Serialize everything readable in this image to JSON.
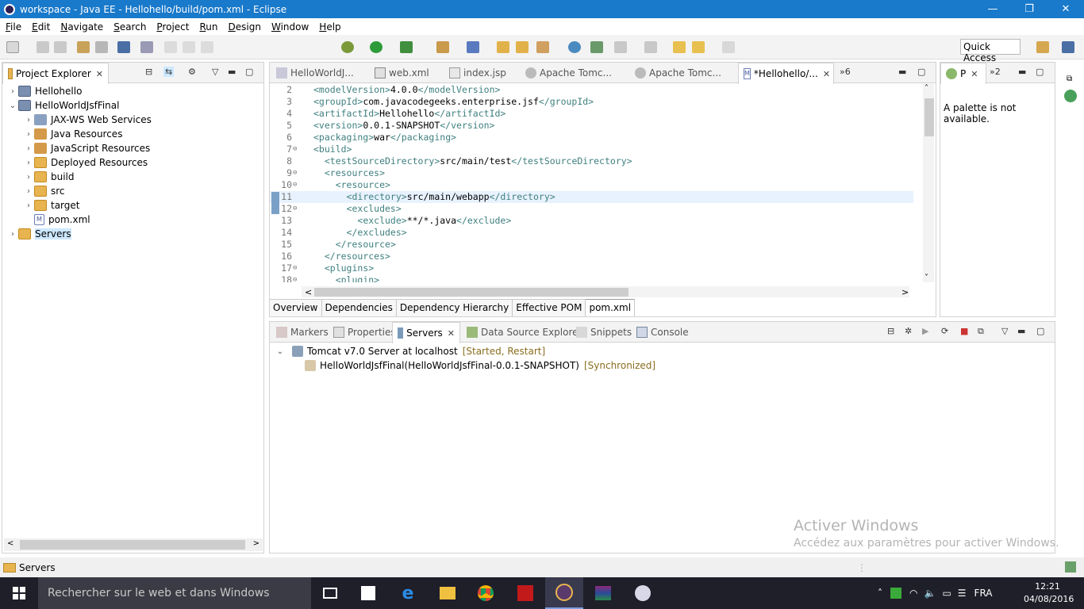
{
  "window": {
    "title": "workspace - Java EE - Hellohello/build/pom.xml - Eclipse",
    "minimize": "—",
    "restore": "❐",
    "close": "✕"
  },
  "menu": [
    "File",
    "Edit",
    "Navigate",
    "Search",
    "Project",
    "Run",
    "Design",
    "Window",
    "Help"
  ],
  "quick_access": "Quick Access",
  "project_explorer": {
    "title": "Project Explorer",
    "items": [
      {
        "label": "Hellohello",
        "twisty": "›"
      },
      {
        "label": "HelloWorldJsfFinal",
        "twisty": "⌄"
      },
      {
        "label": "JAX-WS Web Services",
        "twisty": "›"
      },
      {
        "label": "Java Resources",
        "twisty": "›"
      },
      {
        "label": "JavaScript Resources",
        "twisty": "›"
      },
      {
        "label": "Deployed Resources",
        "twisty": "›"
      },
      {
        "label": "build",
        "twisty": "›"
      },
      {
        "label": "src",
        "twisty": "›"
      },
      {
        "label": "target",
        "twisty": "›"
      },
      {
        "label": "pom.xml",
        "twisty": ""
      },
      {
        "label": "Servers",
        "twisty": "›"
      }
    ]
  },
  "editor": {
    "tabs": [
      "HelloWorldJ...",
      "web.xml",
      "index.jsp",
      "Apache Tomc...",
      "Apache Tomc...",
      "*Hellohello/..."
    ],
    "overflow": "»6",
    "lines": [
      {
        "n": "2",
        "fold": "",
        "indent": "",
        "open": "<modelVersion>",
        "text": "4.0.0",
        "close": "</modelVersion>"
      },
      {
        "n": "3",
        "fold": "",
        "indent": "",
        "open": "<groupId>",
        "text": "com.javacodegeeks.enterprise.jsf",
        "close": "</groupId>"
      },
      {
        "n": "4",
        "fold": "",
        "indent": "",
        "open": "<artifactId>",
        "text": "Hellohello",
        "close": "</artifactId>"
      },
      {
        "n": "5",
        "fold": "",
        "indent": "",
        "open": "<version>",
        "text": "0.0.1-SNAPSHOT",
        "close": "</version>"
      },
      {
        "n": "6",
        "fold": "",
        "indent": "",
        "open": "<packaging>",
        "text": "war",
        "close": "</packaging>"
      },
      {
        "n": "7",
        "fold": "⊖",
        "indent": "",
        "open": "<build>",
        "text": "",
        "close": ""
      },
      {
        "n": "8",
        "fold": "",
        "indent": "  ",
        "open": "<testSourceDirectory>",
        "text": "src/main/test",
        "close": "</testSourceDirectory>"
      },
      {
        "n": "9",
        "fold": "⊖",
        "indent": "  ",
        "open": "<resources>",
        "text": "",
        "close": ""
      },
      {
        "n": "10",
        "fold": "⊖",
        "indent": "    ",
        "open": "<resource>",
        "text": "",
        "close": ""
      },
      {
        "n": "11",
        "fold": "",
        "indent": "      ",
        "open": "<directory>",
        "text": "src/main/webapp",
        "close": "</directory>"
      },
      {
        "n": "12",
        "fold": "⊖",
        "indent": "      ",
        "open": "<excludes>",
        "text": "",
        "close": ""
      },
      {
        "n": "13",
        "fold": "",
        "indent": "        ",
        "open": "<exclude>",
        "text": "**/*.java",
        "close": "</exclude>"
      },
      {
        "n": "14",
        "fold": "",
        "indent": "      ",
        "open": "</excludes>",
        "text": "",
        "close": ""
      },
      {
        "n": "15",
        "fold": "",
        "indent": "    ",
        "open": "</resource>",
        "text": "",
        "close": ""
      },
      {
        "n": "16",
        "fold": "",
        "indent": "  ",
        "open": "</resources>",
        "text": "",
        "close": ""
      },
      {
        "n": "17",
        "fold": "⊖",
        "indent": "  ",
        "open": "<plugins>",
        "text": "",
        "close": ""
      },
      {
        "n": "18",
        "fold": "⊖",
        "indent": "    ",
        "open": "<plugin>",
        "text": "",
        "close": ""
      }
    ],
    "bottom_tabs": [
      "Overview",
      "Dependencies",
      "Dependency Hierarchy",
      "Effective POM",
      "pom.xml"
    ]
  },
  "palette": {
    "tab": "P",
    "overflow": "»2",
    "message": "A palette is not available."
  },
  "bottom_panel": {
    "tabs": [
      "Markers",
      "Properties",
      "Servers",
      "Data Source Explorer",
      "Snippets",
      "Console"
    ],
    "server": {
      "label": "Tomcat v7.0 Server at localhost",
      "state": "[Started, Restart]"
    },
    "module": {
      "label": "HelloWorldJsfFinal(HelloWorldJsfFinal-0.0.1-SNAPSHOT)",
      "state": "[Synchronized]"
    }
  },
  "watermark": {
    "title": "Activer Windows",
    "subtitle": "Accédez aux paramètres pour activer Windows."
  },
  "status": {
    "label": "Servers"
  },
  "taskbar": {
    "search": "Rechercher sur le web et dans Windows",
    "lang": "FRA",
    "time": "12:21",
    "date": "04/08/2016"
  }
}
